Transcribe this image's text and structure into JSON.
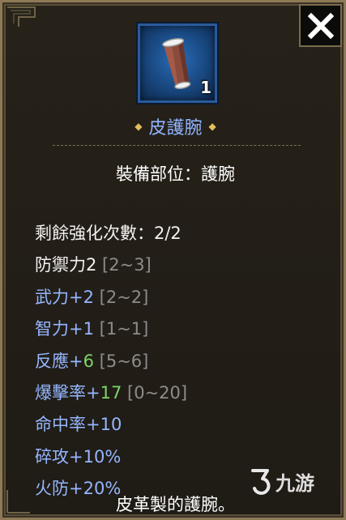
{
  "item": {
    "name": "皮護腕",
    "count": "1",
    "slot_line": "裝備部位：護腕",
    "description": "皮革製的護腕。"
  },
  "stats": [
    {
      "parts": [
        {
          "text": "剩餘強化次數：2/2",
          "color": "white"
        }
      ]
    },
    {
      "parts": [
        {
          "text": "防禦力2 ",
          "color": "white"
        },
        {
          "text": "[2~3]",
          "color": "gray"
        }
      ]
    },
    {
      "parts": [
        {
          "text": "武力+2 ",
          "color": "blue"
        },
        {
          "text": "[2~2]",
          "color": "gray"
        }
      ]
    },
    {
      "parts": [
        {
          "text": "智力+1 ",
          "color": "blue"
        },
        {
          "text": "[1~1]",
          "color": "gray"
        }
      ]
    },
    {
      "parts": [
        {
          "text": "反應+",
          "color": "blue"
        },
        {
          "text": "6 ",
          "color": "green"
        },
        {
          "text": "[5~6]",
          "color": "gray"
        }
      ]
    },
    {
      "parts": [
        {
          "text": "爆擊率+",
          "color": "blue"
        },
        {
          "text": "17 ",
          "color": "green"
        },
        {
          "text": "[0~20]",
          "color": "gray"
        }
      ]
    },
    {
      "parts": [
        {
          "text": "命中率+10",
          "color": "blue"
        }
      ]
    },
    {
      "parts": [
        {
          "text": "碎攻+10%",
          "color": "blue"
        }
      ]
    },
    {
      "parts": [
        {
          "text": "火防+20%",
          "color": "blue"
        }
      ]
    }
  ],
  "watermark": {
    "text": "九游"
  },
  "colors": {
    "name_blue": "#8fb3ff",
    "stat_blue": "#95b6ff",
    "bonus_green": "#7ed46a",
    "range_gray": "#8c8c8c",
    "frame_gold": "#8d7a55"
  }
}
